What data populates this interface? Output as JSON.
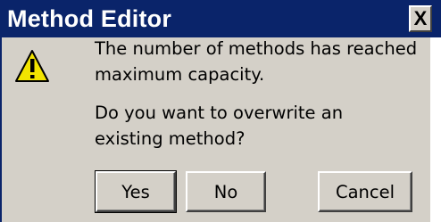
{
  "window": {
    "title": "Method Editor",
    "close_glyph": "X"
  },
  "icon": {
    "name": "warning-icon",
    "color": "#f2e400"
  },
  "message": {
    "line1": "The number of methods has reached",
    "line2": "maximum capacity.",
    "line3": "Do you want to overwrite an",
    "line4": "existing method?"
  },
  "buttons": {
    "yes": "Yes",
    "no": "No",
    "cancel": "Cancel"
  }
}
